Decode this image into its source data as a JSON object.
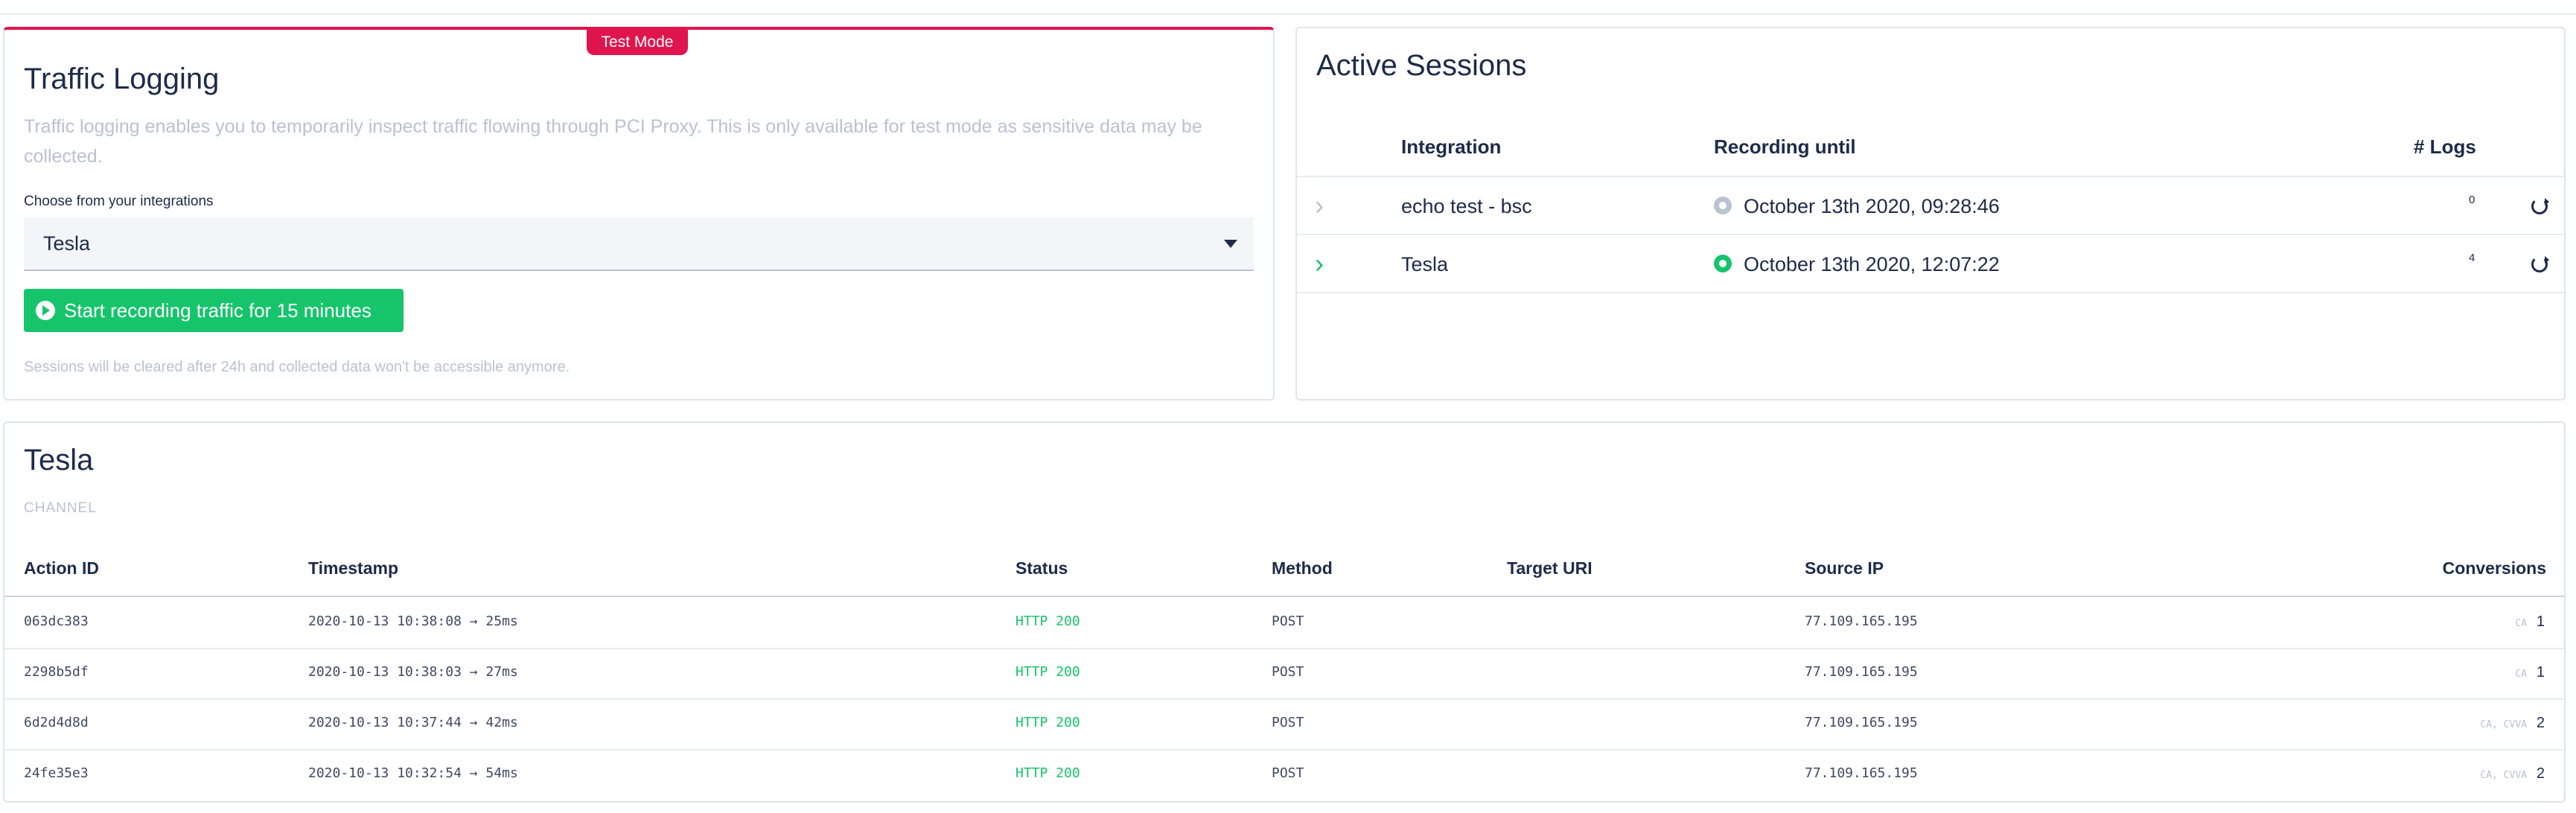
{
  "traffic": {
    "badge": "Test Mode",
    "title": "Traffic Logging",
    "description": "Traffic logging enables you to temporarily inspect traffic flowing through PCI Proxy. This is only available for test mode as sensitive data may be collected.",
    "select_label": "Choose from your integrations",
    "select_value": "Tesla",
    "record_button": "Start recording traffic for 15 minutes",
    "note": "Sessions will be cleared after 24h and collected data won't be accessible anymore."
  },
  "sessions": {
    "title": "Active Sessions",
    "headers": {
      "integration": "Integration",
      "recording": "Recording until",
      "logs": "# Logs"
    },
    "rows": [
      {
        "integration": "echo test - bsc",
        "until": "October 13th 2020, 09:28:46",
        "logs": "0",
        "status_color": "#b9c2d0",
        "chevron_color": "#b9c2d0"
      },
      {
        "integration": "Tesla",
        "until": "October 13th 2020, 12:07:22",
        "logs": "4",
        "status_color": "#16c46c",
        "chevron_color": "#16c46c"
      }
    ]
  },
  "table": {
    "title": "Tesla",
    "subtitle": "CHANNEL",
    "headers": {
      "action_id": "Action ID",
      "timestamp": "Timestamp",
      "status": "Status",
      "method": "Method",
      "target_uri": "Target URI",
      "source_ip": "Source IP",
      "conversions": "Conversions"
    },
    "rows": [
      {
        "action_id": "063dc383",
        "timestamp": "2020-10-13 10:38:08 → 25ms",
        "status": "HTTP 200",
        "method": "POST",
        "target_uri": "",
        "source_ip": "77.109.165.195",
        "conv_types": "CA",
        "conv_count": "1"
      },
      {
        "action_id": "2298b5df",
        "timestamp": "2020-10-13 10:38:03 → 27ms",
        "status": "HTTP 200",
        "method": "POST",
        "target_uri": "",
        "source_ip": "77.109.165.195",
        "conv_types": "CA",
        "conv_count": "1"
      },
      {
        "action_id": "6d2d4d8d",
        "timestamp": "2020-10-13 10:37:44 → 42ms",
        "status": "HTTP 200",
        "method": "POST",
        "target_uri": "",
        "source_ip": "77.109.165.195",
        "conv_types": "CA, CVVA",
        "conv_count": "2"
      },
      {
        "action_id": "24fe35e3",
        "timestamp": "2020-10-13 10:32:54 → 54ms",
        "status": "HTTP 200",
        "method": "POST",
        "target_uri": "",
        "source_ip": "77.109.165.195",
        "conv_types": "CA, CVVA",
        "conv_count": "2"
      }
    ]
  },
  "colors": {
    "accent_red": "#e0154e",
    "success_green": "#16c46c",
    "text_dark": "#1d2b4a",
    "muted": "#b9c2d0"
  }
}
